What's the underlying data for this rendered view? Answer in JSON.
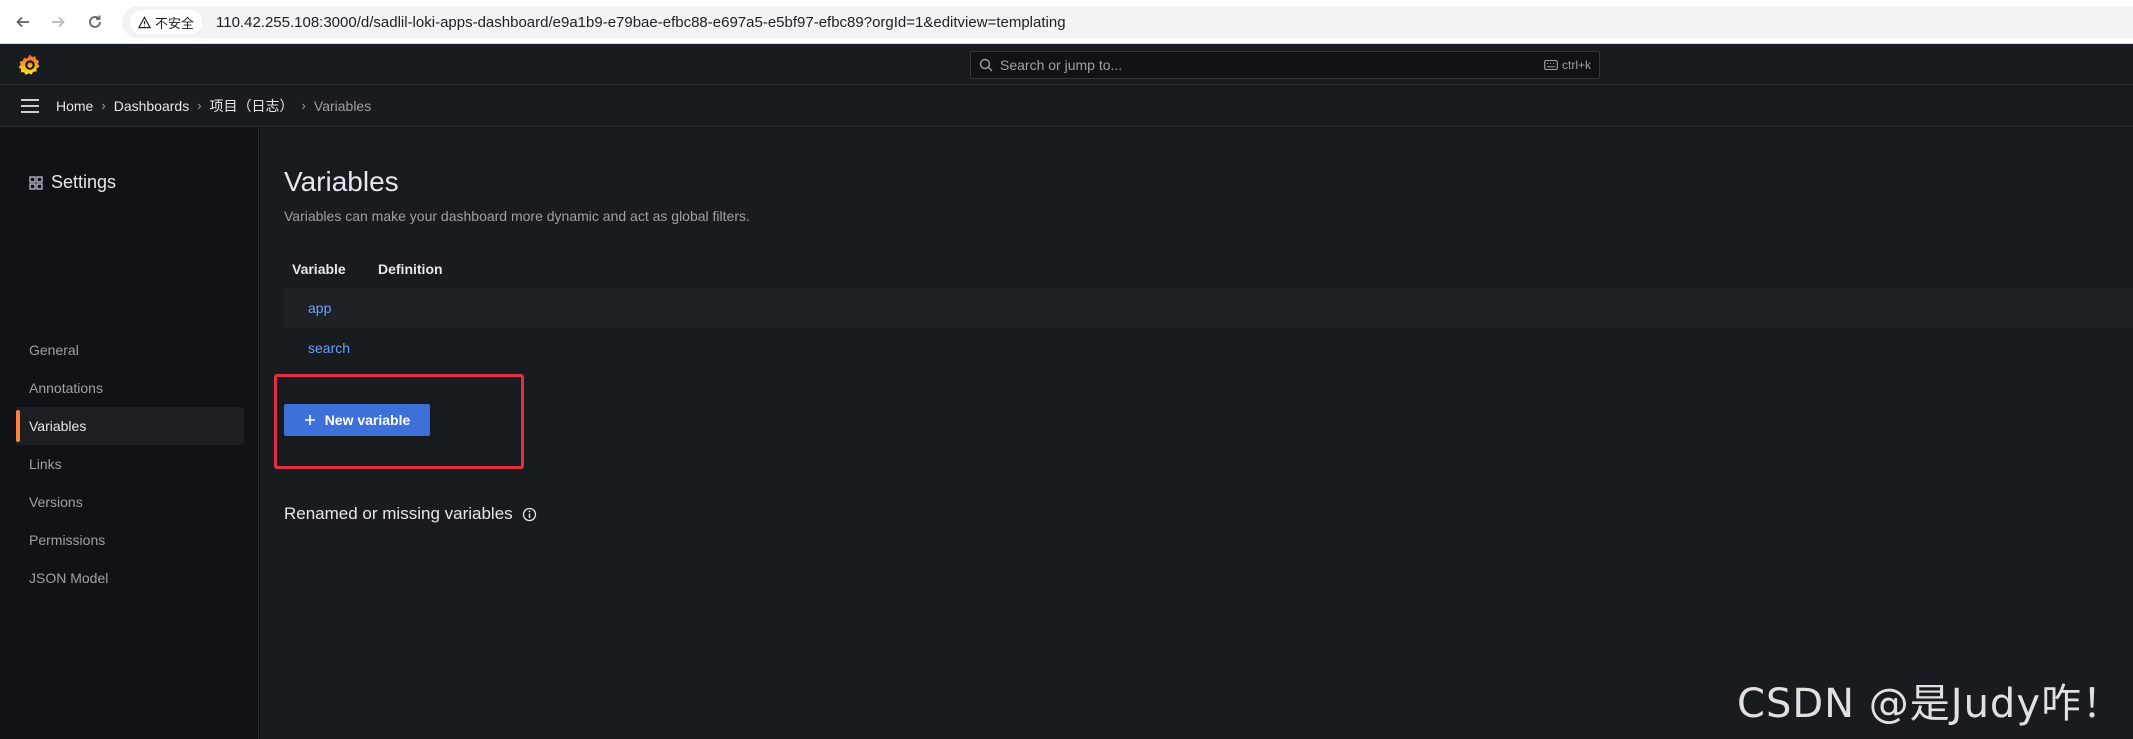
{
  "browser": {
    "insecure_label": "不安全",
    "url": "110.42.255.108:3000/d/sadlil-loki-apps-dashboard/e9a1b9-e79bae-efbc88-e697a5-e5bf97-efbc89?orgId=1&editview=templating"
  },
  "topbar": {
    "search_placeholder": "Search or jump to...",
    "shortcut": "ctrl+k"
  },
  "breadcrumb": {
    "items": [
      "Home",
      "Dashboards",
      "项目（日志）",
      "Variables"
    ],
    "separator": "›"
  },
  "sidebar": {
    "title": "Settings",
    "items": [
      {
        "label": "General"
      },
      {
        "label": "Annotations"
      },
      {
        "label": "Variables"
      },
      {
        "label": "Links"
      },
      {
        "label": "Versions"
      },
      {
        "label": "Permissions"
      },
      {
        "label": "JSON Model"
      }
    ]
  },
  "main": {
    "title": "Variables",
    "subtitle": "Variables can make your dashboard more dynamic and act as global filters.",
    "table": {
      "headers": [
        "Variable",
        "Definition"
      ],
      "rows": [
        {
          "variable": "app",
          "definition": ""
        },
        {
          "variable": "search",
          "definition": ""
        }
      ]
    },
    "new_variable_label": "New variable",
    "renamed_label": "Renamed or missing variables"
  },
  "watermark": "CSDN @是Judy咋！",
  "colors": {
    "accent_orange": "#ff7f40",
    "primary_blue": "#3d71d9",
    "link_blue": "#6e9fff",
    "highlight_red": "#e02f44"
  }
}
